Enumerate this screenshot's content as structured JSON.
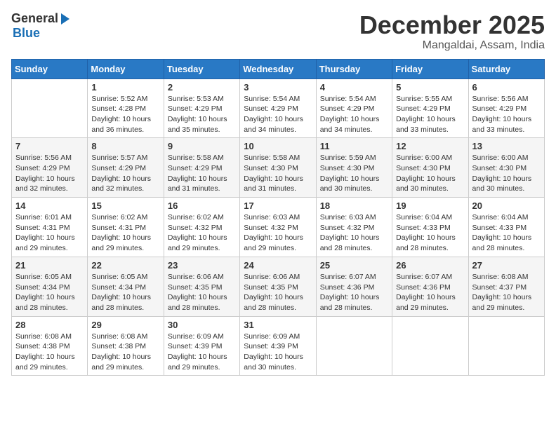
{
  "logo": {
    "general": "General",
    "blue": "Blue"
  },
  "title": "December 2025",
  "location": "Mangaldai, Assam, India",
  "weekdays": [
    "Sunday",
    "Monday",
    "Tuesday",
    "Wednesday",
    "Thursday",
    "Friday",
    "Saturday"
  ],
  "weeks": [
    [
      {
        "day": "",
        "info": ""
      },
      {
        "day": "1",
        "info": "Sunrise: 5:52 AM\nSunset: 4:28 PM\nDaylight: 10 hours\nand 36 minutes."
      },
      {
        "day": "2",
        "info": "Sunrise: 5:53 AM\nSunset: 4:29 PM\nDaylight: 10 hours\nand 35 minutes."
      },
      {
        "day": "3",
        "info": "Sunrise: 5:54 AM\nSunset: 4:29 PM\nDaylight: 10 hours\nand 34 minutes."
      },
      {
        "day": "4",
        "info": "Sunrise: 5:54 AM\nSunset: 4:29 PM\nDaylight: 10 hours\nand 34 minutes."
      },
      {
        "day": "5",
        "info": "Sunrise: 5:55 AM\nSunset: 4:29 PM\nDaylight: 10 hours\nand 33 minutes."
      },
      {
        "day": "6",
        "info": "Sunrise: 5:56 AM\nSunset: 4:29 PM\nDaylight: 10 hours\nand 33 minutes."
      }
    ],
    [
      {
        "day": "7",
        "info": "Sunrise: 5:56 AM\nSunset: 4:29 PM\nDaylight: 10 hours\nand 32 minutes."
      },
      {
        "day": "8",
        "info": "Sunrise: 5:57 AM\nSunset: 4:29 PM\nDaylight: 10 hours\nand 32 minutes."
      },
      {
        "day": "9",
        "info": "Sunrise: 5:58 AM\nSunset: 4:29 PM\nDaylight: 10 hours\nand 31 minutes."
      },
      {
        "day": "10",
        "info": "Sunrise: 5:58 AM\nSunset: 4:30 PM\nDaylight: 10 hours\nand 31 minutes."
      },
      {
        "day": "11",
        "info": "Sunrise: 5:59 AM\nSunset: 4:30 PM\nDaylight: 10 hours\nand 30 minutes."
      },
      {
        "day": "12",
        "info": "Sunrise: 6:00 AM\nSunset: 4:30 PM\nDaylight: 10 hours\nand 30 minutes."
      },
      {
        "day": "13",
        "info": "Sunrise: 6:00 AM\nSunset: 4:30 PM\nDaylight: 10 hours\nand 30 minutes."
      }
    ],
    [
      {
        "day": "14",
        "info": "Sunrise: 6:01 AM\nSunset: 4:31 PM\nDaylight: 10 hours\nand 29 minutes."
      },
      {
        "day": "15",
        "info": "Sunrise: 6:02 AM\nSunset: 4:31 PM\nDaylight: 10 hours\nand 29 minutes."
      },
      {
        "day": "16",
        "info": "Sunrise: 6:02 AM\nSunset: 4:32 PM\nDaylight: 10 hours\nand 29 minutes."
      },
      {
        "day": "17",
        "info": "Sunrise: 6:03 AM\nSunset: 4:32 PM\nDaylight: 10 hours\nand 29 minutes."
      },
      {
        "day": "18",
        "info": "Sunrise: 6:03 AM\nSunset: 4:32 PM\nDaylight: 10 hours\nand 28 minutes."
      },
      {
        "day": "19",
        "info": "Sunrise: 6:04 AM\nSunset: 4:33 PM\nDaylight: 10 hours\nand 28 minutes."
      },
      {
        "day": "20",
        "info": "Sunrise: 6:04 AM\nSunset: 4:33 PM\nDaylight: 10 hours\nand 28 minutes."
      }
    ],
    [
      {
        "day": "21",
        "info": "Sunrise: 6:05 AM\nSunset: 4:34 PM\nDaylight: 10 hours\nand 28 minutes."
      },
      {
        "day": "22",
        "info": "Sunrise: 6:05 AM\nSunset: 4:34 PM\nDaylight: 10 hours\nand 28 minutes."
      },
      {
        "day": "23",
        "info": "Sunrise: 6:06 AM\nSunset: 4:35 PM\nDaylight: 10 hours\nand 28 minutes."
      },
      {
        "day": "24",
        "info": "Sunrise: 6:06 AM\nSunset: 4:35 PM\nDaylight: 10 hours\nand 28 minutes."
      },
      {
        "day": "25",
        "info": "Sunrise: 6:07 AM\nSunset: 4:36 PM\nDaylight: 10 hours\nand 28 minutes."
      },
      {
        "day": "26",
        "info": "Sunrise: 6:07 AM\nSunset: 4:36 PM\nDaylight: 10 hours\nand 29 minutes."
      },
      {
        "day": "27",
        "info": "Sunrise: 6:08 AM\nSunset: 4:37 PM\nDaylight: 10 hours\nand 29 minutes."
      }
    ],
    [
      {
        "day": "28",
        "info": "Sunrise: 6:08 AM\nSunset: 4:38 PM\nDaylight: 10 hours\nand 29 minutes."
      },
      {
        "day": "29",
        "info": "Sunrise: 6:08 AM\nSunset: 4:38 PM\nDaylight: 10 hours\nand 29 minutes."
      },
      {
        "day": "30",
        "info": "Sunrise: 6:09 AM\nSunset: 4:39 PM\nDaylight: 10 hours\nand 29 minutes."
      },
      {
        "day": "31",
        "info": "Sunrise: 6:09 AM\nSunset: 4:39 PM\nDaylight: 10 hours\nand 30 minutes."
      },
      {
        "day": "",
        "info": ""
      },
      {
        "day": "",
        "info": ""
      },
      {
        "day": "",
        "info": ""
      }
    ]
  ]
}
